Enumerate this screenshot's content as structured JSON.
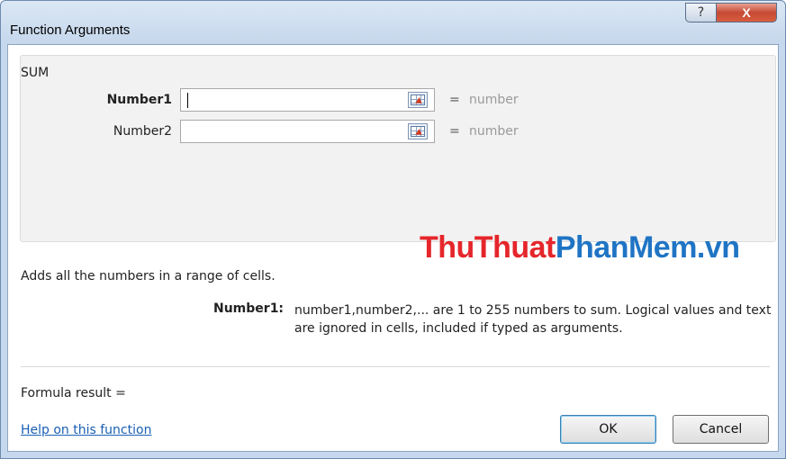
{
  "window": {
    "title": "Function Arguments",
    "help_glyph": "?",
    "close_glyph": "X"
  },
  "function_group": {
    "name": "SUM",
    "arguments": [
      {
        "label": "Number1",
        "value": "",
        "equals": "=",
        "result": "number",
        "bold": true
      },
      {
        "label": "Number2",
        "value": "",
        "equals": "=",
        "result": "number",
        "bold": false
      }
    ]
  },
  "watermark": {
    "part1": "ThuThuat",
    "part2": "PhanMem.vn"
  },
  "description": "Adds all the numbers in a range of cells.",
  "argument_help": {
    "label": "Number1:",
    "text": "number1,number2,... are 1 to 255 numbers to sum. Logical values and text are ignored in cells, included if typed as arguments."
  },
  "formula_result": "Formula result =",
  "help_link": "Help on this function",
  "buttons": {
    "ok": "OK",
    "cancel": "Cancel"
  },
  "colors": {
    "titlebar": "#c5d7ec",
    "close_button": "#c64a34",
    "link": "#1a5fb4",
    "watermark_red": "#e5262b",
    "watermark_blue": "#1f74c4"
  }
}
